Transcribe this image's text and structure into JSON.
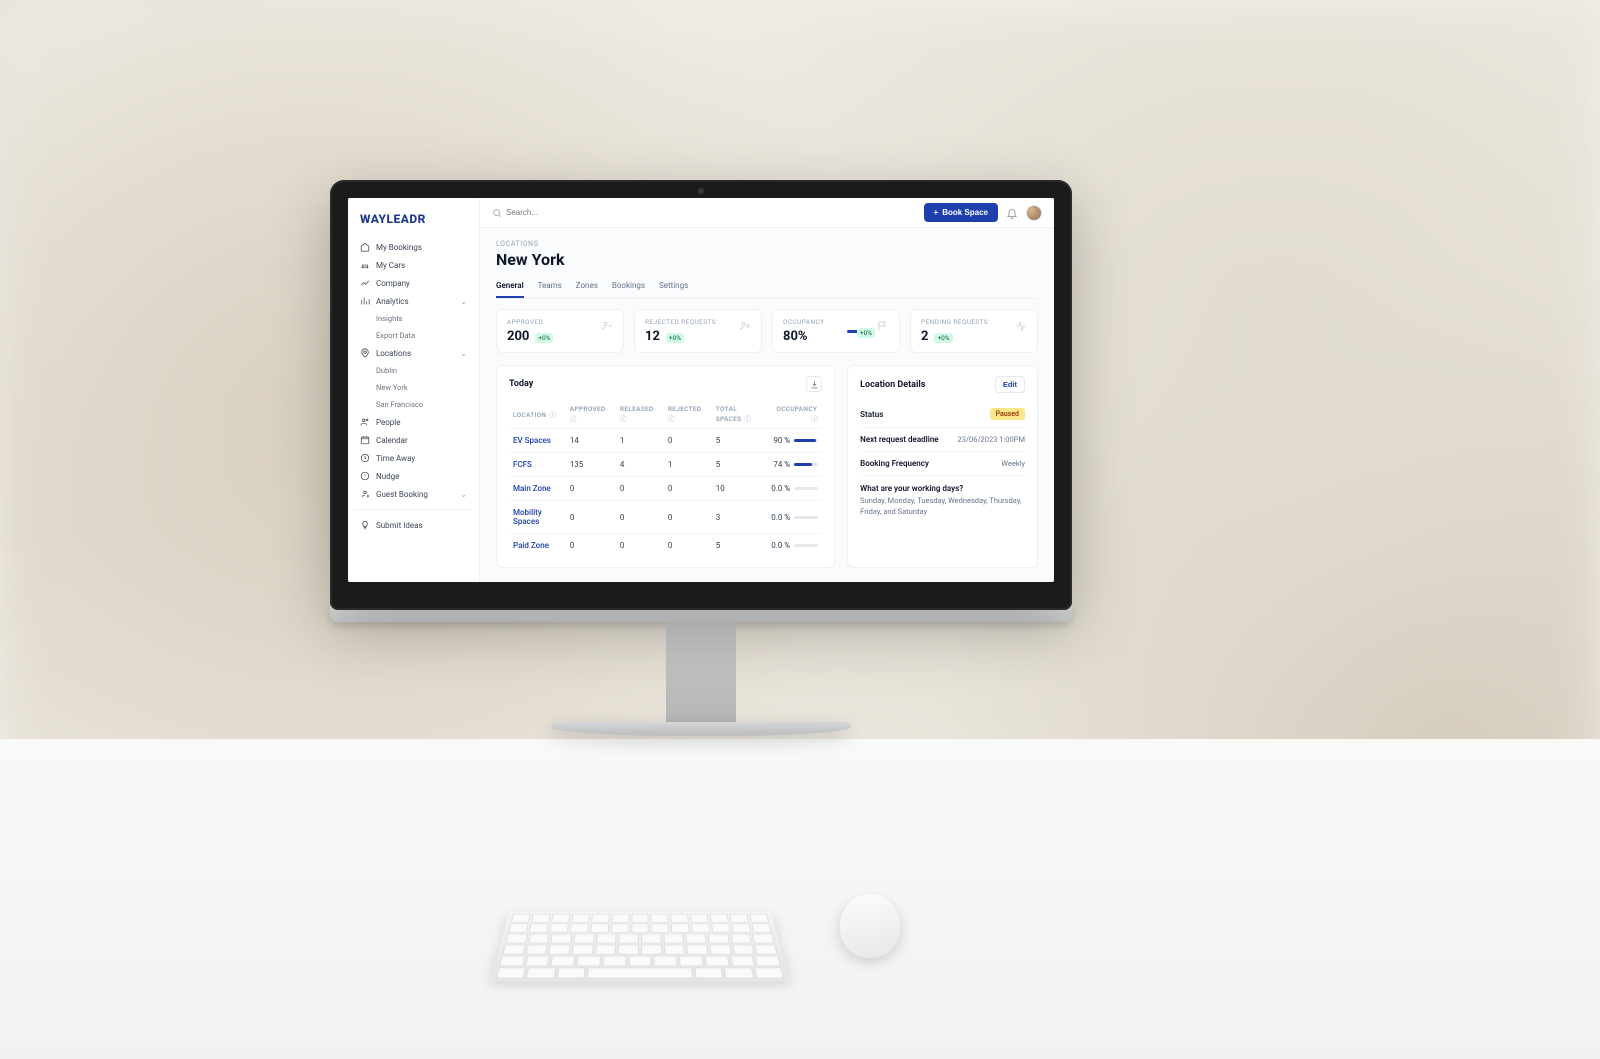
{
  "brand": "WAYLEADR",
  "search": {
    "placeholder": "Search..."
  },
  "header": {
    "book_label": "Book Space"
  },
  "sidebar": {
    "my_bookings": "My Bookings",
    "my_cars": "My Cars",
    "company": "Company",
    "analytics": "Analytics",
    "insights": "Insights",
    "export_data": "Export Data",
    "locations": "Locations",
    "loc_dublin": "Dublin",
    "loc_new_york": "New York",
    "loc_sf": "San Francisco",
    "people": "People",
    "calendar": "Calendar",
    "time_away": "Time Away",
    "nudge": "Nudge",
    "guest_booking": "Guest Booking",
    "submit_ideas": "Submit Ideas"
  },
  "page": {
    "breadcrumb": "LOCATIONS",
    "title": "New York",
    "tabs": {
      "general": "General",
      "teams": "Teams",
      "zones": "Zones",
      "bookings": "Bookings",
      "settings": "Settings"
    }
  },
  "kpi": {
    "approved": {
      "label": "APPROVED",
      "value": "200",
      "delta": "+0%"
    },
    "rejected": {
      "label": "REJECTED REQUESTS",
      "value": "12",
      "delta": "+0%"
    },
    "occupancy": {
      "label": "OCCUPANCY",
      "value": "80%",
      "delta": "+0%"
    },
    "pending": {
      "label": "PENDING REQUESTS",
      "value": "2",
      "delta": "+0%"
    }
  },
  "today": {
    "title": "Today",
    "cols": {
      "location": "LOCATION",
      "approved": "APPROVED",
      "released": "RELEASED",
      "rejected": "REJECTED",
      "total": "TOTAL SPACES",
      "occupancy": "OCCUPANCY"
    },
    "rows": [
      {
        "location": "EV Spaces",
        "approved": "14",
        "released": "1",
        "rejected": "0",
        "total": "5",
        "occupancy": "90 %",
        "pct": 90
      },
      {
        "location": "FCFS",
        "approved": "135",
        "released": "4",
        "rejected": "1",
        "total": "5",
        "occupancy": "74 %",
        "pct": 74
      },
      {
        "location": "Main Zone",
        "approved": "0",
        "released": "0",
        "rejected": "0",
        "total": "10",
        "occupancy": "0.0 %",
        "pct": 0
      },
      {
        "location": "Mobility Spaces",
        "approved": "0",
        "released": "0",
        "rejected": "0",
        "total": "3",
        "occupancy": "0.0 %",
        "pct": 0
      },
      {
        "location": "Paid Zone",
        "approved": "0",
        "released": "0",
        "rejected": "0",
        "total": "5",
        "occupancy": "0.0 %",
        "pct": 0
      }
    ]
  },
  "details": {
    "title": "Location Details",
    "edit": "Edit",
    "status_label": "Status",
    "status_value": "Paused",
    "deadline_label": "Next request deadline",
    "deadline_value": "23/06/2023 1:00PM",
    "frequency_label": "Booking Frequency",
    "frequency_value": "Weekly",
    "working_q": "What are your working days?",
    "working_a": "Sunday, Monday, Tuesday, Wednesday, Thursday, Friday, and Saturday"
  }
}
